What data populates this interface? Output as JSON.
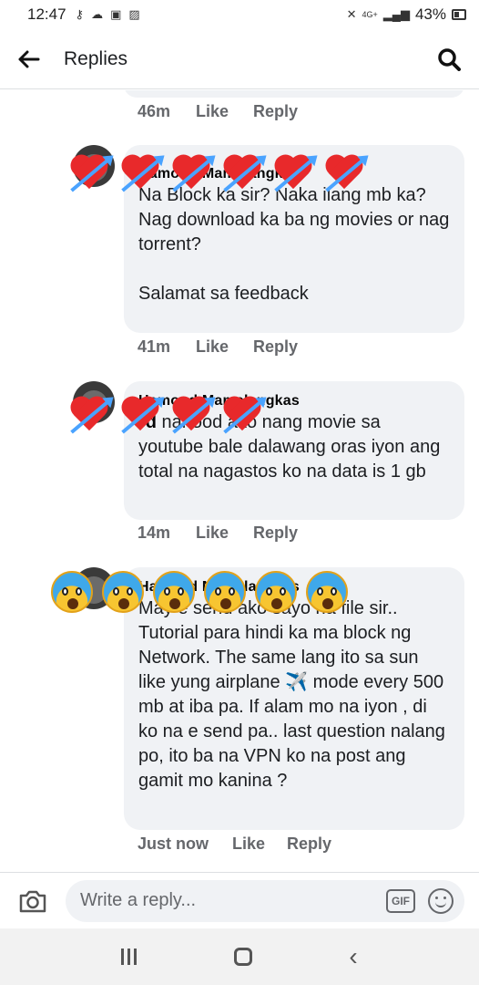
{
  "status_bar": {
    "time": "12:47",
    "network": "4G+",
    "battery": "43%"
  },
  "header": {
    "title": "Replies",
    "back_icon": "arrow-left-icon",
    "search_icon": "search-icon"
  },
  "top_actions": {
    "time": "46m",
    "like": "Like",
    "reply": "Reply"
  },
  "comments": [
    {
      "author": "Hamoud Mamalangkas",
      "text": "Na Block ka sir? Naka ilang mb ka? Nag download ka ba ng movies or nag torrent?\n\nSalamat sa feedback",
      "time": "41m",
      "like": "Like",
      "reply": "Reply"
    },
    {
      "author": "Hamoud Mamalangkas",
      "mention": "rd",
      "text": " nanood ako nang movie sa youtube bale dalawang oras iyon ang total na nagastos ko na data is 1 gb",
      "time": "14m",
      "like": "Like",
      "reply": "Reply"
    },
    {
      "author": "Hamoud Mamalangkas",
      "text": "May e send ako sayo na file sir.. Tutorial para hindi ka ma block ng Network. The same lang ito sa sun like yung airplane ✈️ mode every 500 mb at iba pa. If alam mo na iyon , di ko na e send pa.. last question nalang po, ito ba na VPN ko na post ang gamit mo kanina ?",
      "time": "Just now",
      "like": "Like",
      "reply": "Reply"
    }
  ],
  "composer": {
    "placeholder": "Write a reply...",
    "gif_label": "GIF",
    "camera_icon": "camera-icon",
    "emoji_icon": "emoji-icon"
  }
}
